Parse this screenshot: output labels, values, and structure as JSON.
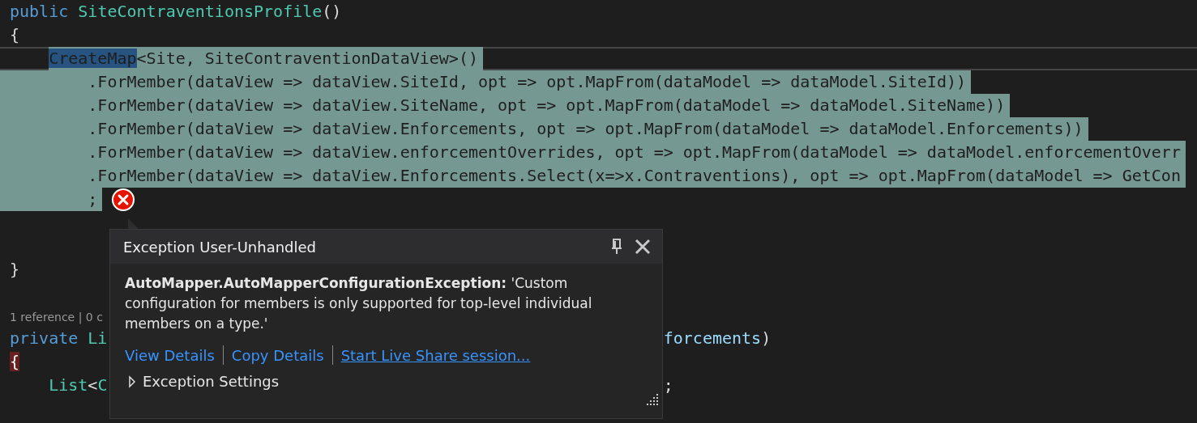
{
  "code_lines": [
    {
      "kind": "code",
      "segments": [
        {
          "kind": "keyword",
          "text": "public "
        },
        {
          "kind": "type",
          "text": "SiteContraventionsProfile"
        },
        {
          "kind": "plain",
          "text": "()"
        }
      ]
    },
    {
      "kind": "code",
      "segments": [
        {
          "kind": "plain",
          "text": "{"
        }
      ]
    },
    {
      "kind": "block",
      "selected": true,
      "current": true,
      "segments": [
        {
          "kind": "highlight",
          "text": "CreateMap"
        },
        {
          "kind": "plain",
          "text": "<Site, SiteContraventionDataView>()"
        }
      ]
    },
    {
      "kind": "chain",
      "selected": true,
      "segments": [
        {
          "kind": "plain",
          "text": ".ForMember(dataView => dataView.SiteId, opt => opt.MapFrom(dataModel => dataModel.SiteId))"
        }
      ]
    },
    {
      "kind": "chain",
      "selected": true,
      "segments": [
        {
          "kind": "plain",
          "text": ".ForMember(dataView => dataView.SiteName, opt => opt.MapFrom(dataModel => dataModel.SiteName))"
        }
      ]
    },
    {
      "kind": "chain",
      "selected": true,
      "segments": [
        {
          "kind": "plain",
          "text": ".ForMember(dataView => dataView.Enforcements, opt => opt.MapFrom(dataModel => dataModel.Enforcements))"
        }
      ]
    },
    {
      "kind": "chain",
      "selected": true,
      "segments": [
        {
          "kind": "plain",
          "text": ".ForMember(dataView => dataView.enforcementOverrides, opt => opt.MapFrom(dataModel => dataModel.enforcementOverr"
        }
      ]
    },
    {
      "kind": "chain",
      "selected": true,
      "segments": [
        {
          "kind": "plain",
          "text": ".ForMember(dataView => dataView.Enforcements.Select(x=>x.Contraventions), opt => opt.MapFrom(dataModel => GetCon"
        }
      ]
    },
    {
      "kind": "chain",
      "selected": true,
      "error": true,
      "segments": [
        {
          "kind": "plain",
          "text": ";"
        }
      ]
    },
    {
      "kind": "code"
    },
    {
      "kind": "code"
    },
    {
      "kind": "code",
      "segments": [
        {
          "kind": "plain",
          "text": "}"
        }
      ]
    },
    {
      "kind": "code"
    },
    {
      "kind": "codelens",
      "text": "1 reference | 0 c"
    },
    {
      "kind": "code",
      "segments": [
        {
          "kind": "keyword",
          "text": "private "
        },
        {
          "kind": "type",
          "text": "Li"
        }
      ],
      "right": [
        {
          "kind": "member",
          "text": "forcements"
        },
        {
          "kind": "plain",
          "text": ")"
        }
      ]
    },
    {
      "kind": "code",
      "segments": [
        {
          "kind": "brace",
          "text": "{"
        }
      ]
    },
    {
      "kind": "block",
      "segments": [
        {
          "kind": "type",
          "text": "List"
        },
        {
          "kind": "plain",
          "text": "<"
        },
        {
          "kind": "type",
          "text": "C"
        }
      ],
      "right": [
        {
          "kind": "plain",
          "text": ";"
        }
      ]
    }
  ],
  "exception_popup": {
    "title": "Exception User-Unhandled",
    "message": "**AutoMapper.AutoMapperConfigurationException:** 'Custom configuration for members is only supported for top-level individual members on a type.'",
    "links": [
      "View Details",
      "Copy Details",
      "Start Live Share session..."
    ],
    "settings_label": "Exception Settings",
    "settings_expanded": false
  }
}
